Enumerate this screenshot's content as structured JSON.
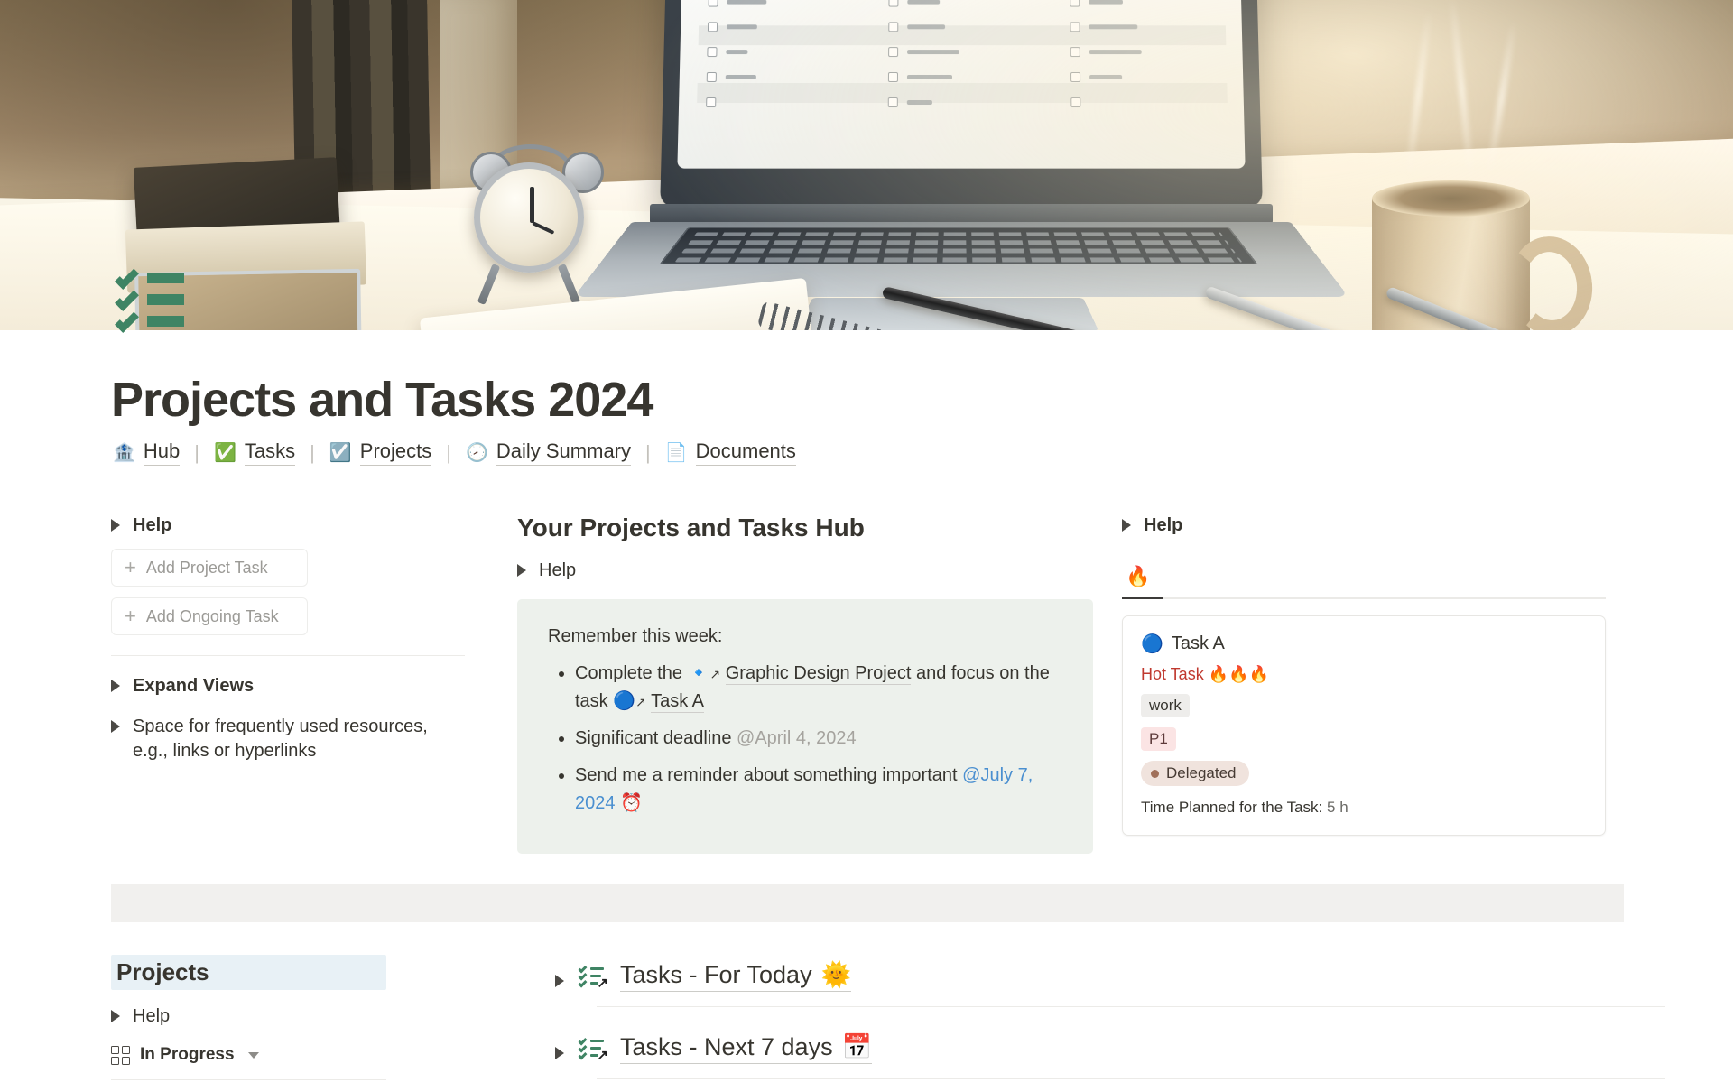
{
  "hero": {
    "alt": "desk scene with laptop, alarm clock, books, pens and coffee mug"
  },
  "logo": {
    "name": "green-checklist-logo"
  },
  "header": {
    "title": "Projects and Tasks 2024"
  },
  "nav": {
    "items": [
      {
        "icon": "bank-icon",
        "glyph": "🏦",
        "label": "Hub"
      },
      {
        "icon": "check-mark-button-icon",
        "glyph": "✅",
        "label": "Tasks"
      },
      {
        "icon": "ballot-box-with-check-icon",
        "glyph": "☑️",
        "label": "Projects"
      },
      {
        "icon": "clock-icon",
        "glyph": "🕗",
        "label": "Daily Summary"
      },
      {
        "icon": "page-icon",
        "glyph": "📄",
        "label": "Documents"
      }
    ],
    "separator": "|"
  },
  "left_sidebar": {
    "help_label": "Help",
    "buttons": [
      {
        "label": "Add Project Task",
        "icon": "plus-icon"
      },
      {
        "label": "Add Ongoing Task",
        "icon": "plus-icon"
      }
    ],
    "expand_views_label": "Expand Views",
    "resources_label": "Space for frequently used resources, e.g., links or hyperlinks"
  },
  "main": {
    "title": "Your Projects and Tasks Hub",
    "help_label": "Help",
    "callout": {
      "lead": "Remember this week:",
      "items": [
        {
          "prefix": "Complete the",
          "link1_icon": "blue-square-link-icon",
          "link1": "Graphic Design Project",
          "middle": "and focus on the task",
          "link2_icon": "blue-circle-link-icon",
          "link2": "Task A"
        },
        {
          "text": "Significant deadline",
          "date": "@April 4, 2024",
          "date_color": "#a5a39e"
        },
        {
          "text": "Send me a reminder about something important",
          "date": "@July 7, 2024",
          "date_icon": "alarm-clock-icon",
          "date_color": "#4a8fd0"
        }
      ]
    }
  },
  "right_panel": {
    "help_label": "Help",
    "tab": {
      "icon": "fire-icon",
      "glyph": "🔥",
      "label": "",
      "active": true
    },
    "card": {
      "icon": "blue-circle-icon",
      "title": "Task A",
      "hot_label": "Hot Task 🔥🔥🔥",
      "tag": "work",
      "priority": "P1",
      "status": "Delegated",
      "meta_label": "Time Planned for the Task:",
      "meta_value": "5 h"
    }
  },
  "projects_section": {
    "db_title": "Projects",
    "help_label": "Help",
    "view": {
      "icon": "gallery-view-icon",
      "label": "In Progress",
      "chevron": "chevron-down-icon"
    }
  },
  "task_links": [
    {
      "icon": "checklist-link-icon",
      "label": "Tasks - For Today",
      "emoji": "🌞"
    },
    {
      "icon": "checklist-link-icon",
      "label": "Tasks - Next 7 days",
      "emoji": "📅"
    }
  ],
  "colors": {
    "brand_green": "#3f8464",
    "callout_bg": "#edf1ec",
    "db_header_bg": "#e8f1f6",
    "grey_bar": "#f1f0ee",
    "hot_red": "#c0392f",
    "link_blue": "#4a8fd0",
    "date_grey": "#a5a39e"
  }
}
